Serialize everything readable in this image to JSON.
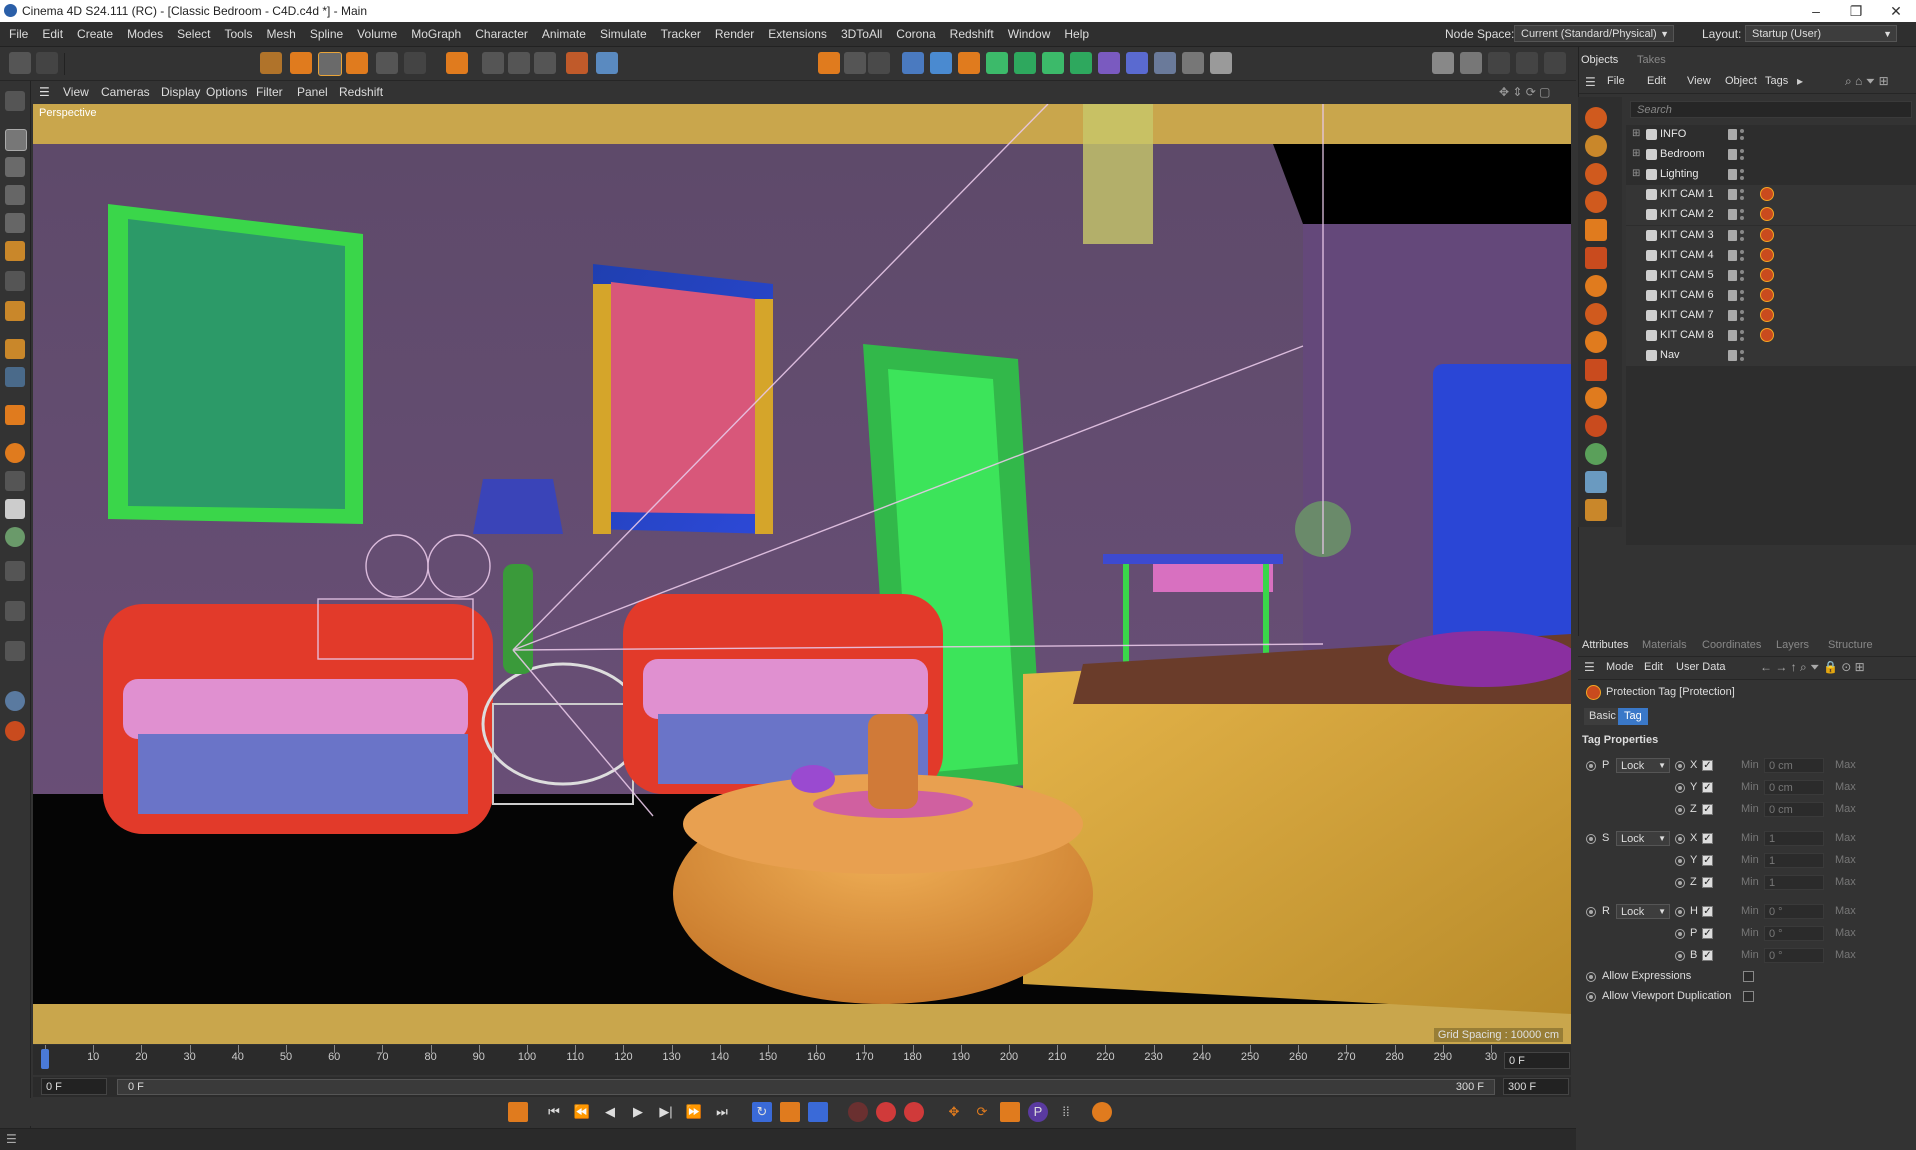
{
  "window": {
    "title": "Cinema 4D S24.111 (RC) - [Classic Bedroom - C4D.c4d *] - Main"
  },
  "menubar": {
    "items": [
      "File",
      "Edit",
      "Create",
      "Modes",
      "Select",
      "Tools",
      "Mesh",
      "Spline",
      "Volume",
      "MoGraph",
      "Character",
      "Animate",
      "Simulate",
      "Tracker",
      "Render",
      "Extensions",
      "3DToAll",
      "Corona",
      "Redshift",
      "Window",
      "Help"
    ],
    "node_space_label": "Node Space:",
    "node_space_value": "Current (Standard/Physical)",
    "layout_label": "Layout:",
    "layout_value": "Startup (User)"
  },
  "viewport": {
    "menu": [
      "View",
      "Cameras",
      "Display",
      "Options",
      "Filter",
      "Panel",
      "Redshift"
    ],
    "label": "Perspective",
    "grid_spacing": "Grid Spacing : 10000 cm"
  },
  "timeline": {
    "ticks": [
      "0",
      "10",
      "20",
      "30",
      "40",
      "50",
      "60",
      "70",
      "80",
      "90",
      "100",
      "110",
      "120",
      "130",
      "140",
      "150",
      "160",
      "170",
      "180",
      "190",
      "200",
      "210",
      "220",
      "230",
      "240",
      "250",
      "260",
      "270",
      "280",
      "290",
      "30"
    ],
    "current_frame": "0 F",
    "start_field": "0 F",
    "range_start": "0 F",
    "range_end": "300 F",
    "end_field": "300 F"
  },
  "objects_panel": {
    "tabs": [
      "Objects",
      "Takes"
    ],
    "menu": [
      "File",
      "Edit",
      "View",
      "Object",
      "Tags"
    ],
    "search_placeholder": "Search",
    "items": [
      {
        "name": "INFO",
        "type": "layer",
        "tag": false
      },
      {
        "name": "Bedroom",
        "type": "layer",
        "tag": false
      },
      {
        "name": "Lighting",
        "type": "layer",
        "tag": false
      },
      {
        "name": "KIT CAM 1",
        "type": "camera",
        "tag": true
      },
      {
        "name": "KIT CAM 2",
        "type": "camera",
        "tag": true
      },
      {
        "name": "KIT CAM 3",
        "type": "camera",
        "tag": true
      },
      {
        "name": "KIT CAM 4",
        "type": "camera",
        "tag": true
      },
      {
        "name": "KIT CAM 5",
        "type": "camera",
        "tag": true
      },
      {
        "name": "KIT CAM 6",
        "type": "camera",
        "tag": true
      },
      {
        "name": "KIT CAM 7",
        "type": "camera",
        "tag": true
      },
      {
        "name": "KIT CAM 8",
        "type": "camera",
        "tag": true
      },
      {
        "name": "Nav",
        "type": "camera",
        "tag": false
      }
    ]
  },
  "attributes_panel": {
    "tabs": [
      "Attributes",
      "Materials",
      "Coordinates",
      "Layers",
      "Structure"
    ],
    "menu": [
      "Mode",
      "Edit",
      "User Data"
    ],
    "object_title": "Protection Tag [Protection]",
    "subtabs": [
      "Basic",
      "Tag"
    ],
    "section": "Tag Properties",
    "groups": [
      {
        "label": "P",
        "mode": "Lock",
        "axes": [
          {
            "a": "X",
            "min": "0 cm"
          },
          {
            "a": "Y",
            "min": "0 cm"
          },
          {
            "a": "Z",
            "min": "0 cm"
          }
        ]
      },
      {
        "label": "S",
        "mode": "Lock",
        "axes": [
          {
            "a": "X",
            "min": "1"
          },
          {
            "a": "Y",
            "min": "1"
          },
          {
            "a": "Z",
            "min": "1"
          }
        ]
      },
      {
        "label": "R",
        "mode": "Lock",
        "axes": [
          {
            "a": "H",
            "min": "0 °"
          },
          {
            "a": "P",
            "min": "0 °"
          },
          {
            "a": "B",
            "min": "0 °"
          }
        ]
      }
    ],
    "min_label": "Min",
    "max_label": "Max",
    "allow_expressions": "Allow Expressions",
    "allow_viewport_dup": "Allow Viewport Duplication"
  }
}
